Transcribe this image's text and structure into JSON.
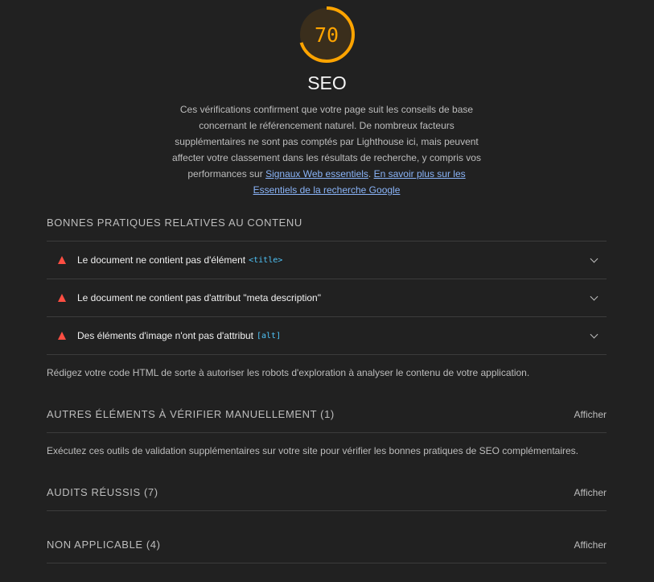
{
  "category": {
    "score": "70",
    "score_fraction": 0.7,
    "gauge_color": "#ffa400",
    "title": "SEO",
    "desc_text": "Ces vérifications confirment que votre page suit les conseils de base concernant le référencement naturel. De nombreux facteurs supplémentaires ne sont pas comptés par Lighthouse ici, mais peuvent affecter votre classement dans les résultats de recherche, y compris vos performances sur ",
    "link1": "Signaux Web essentiels",
    "sep": ". ",
    "link2": "En savoir plus sur les Essentiels de la recherche Google"
  },
  "content_group": {
    "title": "BONNES PRATIQUES RELATIVES AU CONTENU",
    "audits": [
      {
        "label": "Le document ne contient pas d'élément",
        "code": "<title>",
        "icon": "fail-triangle-icon"
      },
      {
        "label": "Le document ne contient pas d'attribut \"meta description\"",
        "code": "",
        "icon": "fail-triangle-icon"
      },
      {
        "label": "Des éléments d'image n'ont pas d'attribut",
        "code": "[alt]",
        "icon": "fail-triangle-icon"
      }
    ],
    "description": "Rédigez votre code HTML de sorte à autoriser les robots d'exploration à analyser le contenu de votre application."
  },
  "manual": {
    "title": "AUTRES ÉLÉMENTS À VÉRIFIER MANUELLEMENT (1)",
    "show": "Afficher",
    "description": "Exécutez ces outils de validation supplémentaires sur votre site pour vérifier les bonnes pratiques de SEO complémentaires."
  },
  "passed": {
    "title": "AUDITS RÉUSSIS (7)",
    "show": "Afficher"
  },
  "na": {
    "title": "NON APPLICABLE (4)",
    "show": "Afficher"
  },
  "colors": {
    "fail": "#ff4e42",
    "link": "#8ab4f8",
    "code": "#4fc3f7"
  }
}
